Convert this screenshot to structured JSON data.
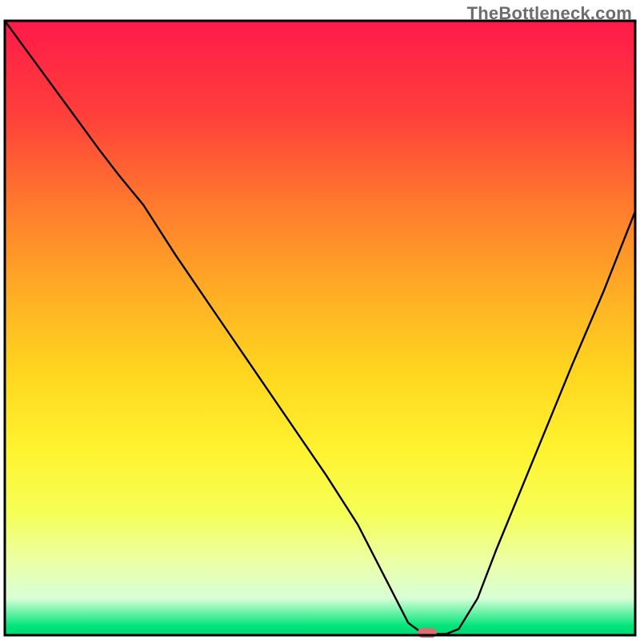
{
  "watermark": "TheBottleneck.com",
  "chart_data": {
    "type": "line",
    "title": "",
    "xlabel": "",
    "ylabel": "",
    "xlim": [
      0,
      100
    ],
    "ylim": [
      0,
      100
    ],
    "legend": false,
    "grid": false,
    "background_gradient_stops": [
      {
        "offset": 0.0,
        "color": "#ff1a49"
      },
      {
        "offset": 0.15,
        "color": "#ff3e3b"
      },
      {
        "offset": 0.3,
        "color": "#ff7a2d"
      },
      {
        "offset": 0.45,
        "color": "#ffb024"
      },
      {
        "offset": 0.58,
        "color": "#ffd81f"
      },
      {
        "offset": 0.7,
        "color": "#fff330"
      },
      {
        "offset": 0.8,
        "color": "#f5ff55"
      },
      {
        "offset": 0.88,
        "color": "#ecffa6"
      },
      {
        "offset": 0.94,
        "color": "#d8ffd6"
      },
      {
        "offset": 0.985,
        "color": "#00e57a"
      },
      {
        "offset": 1.0,
        "color": "#00d873"
      }
    ],
    "series": [
      {
        "name": "bottleneck-curve",
        "x": [
          0,
          5,
          10,
          15,
          18,
          22,
          27,
          33,
          39,
          45,
          51,
          56,
          60,
          62.5,
          64,
          66,
          68,
          70,
          72,
          75,
          78,
          82,
          86,
          90,
          95,
          100
        ],
        "y": [
          100,
          93,
          86,
          79,
          75,
          70,
          62,
          53,
          44,
          35,
          26,
          18,
          10,
          5,
          2,
          0.5,
          0.2,
          0.2,
          1,
          6,
          14,
          24,
          34,
          44,
          56,
          69
        ]
      }
    ],
    "marker": {
      "name": "optimum-marker",
      "x": 67,
      "y": 0,
      "color": "#d96f6f"
    }
  }
}
